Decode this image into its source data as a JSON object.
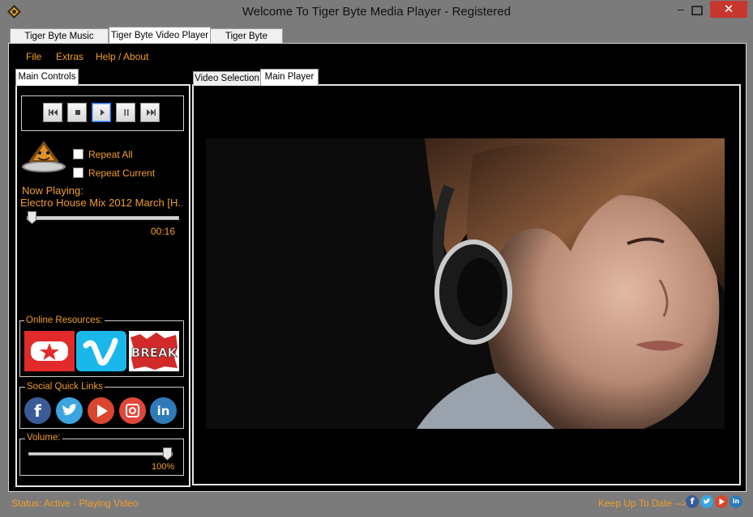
{
  "window": {
    "title": "Welcome To Tiger Byte Media Player - Registered",
    "minimize_glyph": "‒",
    "close_glyph": "✕"
  },
  "tabs": [
    {
      "label": "Tiger Byte Music Player"
    },
    {
      "label": "Tiger Byte Video Player"
    },
    {
      "label": "Tiger Byte Online"
    }
  ],
  "menu": {
    "file": "File",
    "extras": "Extras",
    "help": "Help / About"
  },
  "left_panel": {
    "tab_label": "Main Controls",
    "repeat_all": "Repeat All",
    "repeat_current": "Repeat Current",
    "now_playing_label": "Now Playing:",
    "now_playing_track": "Electro House Mix 2012 March [H...",
    "elapsed": "00:16",
    "seek_fraction": 0.02,
    "online_resources_label": "Online Resources:",
    "social_label": "Social Quick Links",
    "volume_label": "Volume:",
    "volume_value": "100%",
    "break_text": "BREAK"
  },
  "player": {
    "tab_video_selection": "Video Selection",
    "tab_main_player": "Main Player"
  },
  "statusbar": {
    "status": "Status: Active - Playing Video",
    "keep_up": "Keep Up To Date -->"
  },
  "icons": {
    "facebook_glyph": "f",
    "linkedin_glyph": "in",
    "instagram_glyph": "◙",
    "twitter_glyph": "🐦"
  },
  "colors": {
    "accent": "#f19e2a",
    "background": "#000000",
    "window_chrome": "#7b7b7b",
    "close": "#c7372f"
  }
}
